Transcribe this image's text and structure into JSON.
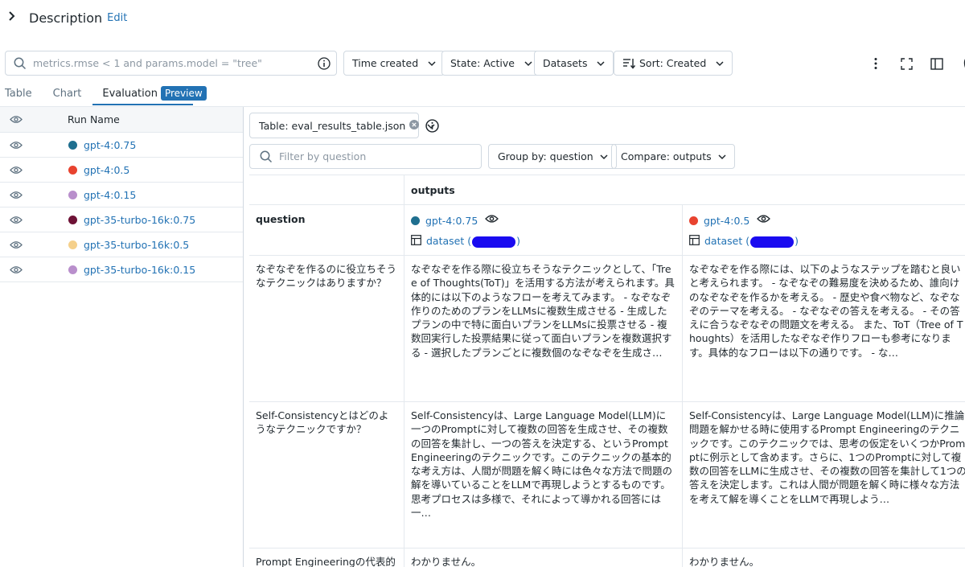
{
  "description": {
    "title": "Description",
    "edit_label": "Edit"
  },
  "search": {
    "placeholder": "metrics.rmse < 1 and params.model = \"tree\""
  },
  "toolbar": {
    "time_created": "Time created",
    "state": "State: Active",
    "datasets": "Datasets",
    "sort": "Sort: Created"
  },
  "tabs": [
    {
      "label": "Table"
    },
    {
      "label": "Chart"
    },
    {
      "label": "Evaluation",
      "badge": "Preview"
    }
  ],
  "runs_panel": {
    "header": "Run Name",
    "runs": [
      {
        "name": "gpt-4:0.75",
        "color": "#1f6f8f"
      },
      {
        "name": "gpt-4:0.5",
        "color": "#e8432f"
      },
      {
        "name": "gpt-4:0.15",
        "color": "#b98fcc"
      },
      {
        "name": "gpt-35-turbo-16k:0.75",
        "color": "#6e1236"
      },
      {
        "name": "gpt-35-turbo-16k:0.5",
        "color": "#f5d08b"
      },
      {
        "name": "gpt-35-turbo-16k:0.15",
        "color": "#b98fcc"
      }
    ]
  },
  "eval": {
    "table_select": "Table: eval_results_table.json",
    "filter_placeholder": "Filter by question",
    "group_by": "Group by: question",
    "compare": "Compare: outputs",
    "outputs_header": "outputs",
    "question_header": "question",
    "columns": [
      {
        "run": "gpt-4:0.75",
        "color": "#1f6f8f",
        "dataset_label": "dataset (",
        "dataset_close": ")"
      },
      {
        "run": "gpt-4:0.5",
        "color": "#e8432f",
        "dataset_label": "dataset (",
        "dataset_close": ")"
      }
    ],
    "rows": [
      {
        "question": "なぞなぞを作るのに役立ちそうなテクニックはありますか？",
        "answers": [
          "なぞなぞを作る際に役立ちそうなテクニックとして、「Tree of Thoughts(ToT)」を活用する方法が考えられます。具体的には以下のようなフローを考えてみます。 - なぞなぞ作りのためのプランをLLMsに複数生成させる - 生成したプランの中で特に面白いプランをLLMsに投票させる - 複数回実行した投票結果に従って面白いプランを複数選択する - 選択したプランごとに複数個のなぞなぞを生成さ…",
          "なぞなぞを作る際には、以下のようなステップを踏むと良いと考えられます。 - なぞなぞの難易度を決めるため、誰向けのなぞなぞを作るかを考える。 - 歴史や食べ物など、なぞなぞのテーマを考える。 - なぞなぞの答えを考える。 - その答えに合うなぞなぞの問題文を考える。 また、ToT（Tree of Thoughts）を活用したなぞなぞ作りフローも参考になります。具体的なフローは以下の通りです。 - な…"
        ]
      },
      {
        "question": "Self-Consistencyとはどのようなテクニックですか？",
        "answers": [
          "Self-Consistencyは、Large Language Model(LLM)に一つのPromptに対して複数の回答を生成させ、その複数の回答を集計し、一つの答えを決定する、というPrompt Engineeringのテクニックです。このテクニックの基本的な考え方は、人間が問題を解く時には色々な方法で問題の解を導いていることをLLMで再現しようとするものです。思考プロセスは多様で、それによって導かれる回答には一…",
          "Self-Consistencyは、Large Language Model(LLM)に推論問題を解かせる時に使用するPrompt Engineeringのテクニックです。このテクニックでは、思考の仮定をいくつかPromptに例示として含めます。さらに、1つのPromptに対して複数の回答をLLMに生成させ、その複数の回答を集計して1つの答えを決定します。これは人間が問題を解く時に様々な方法を考えて解を導くことをLLMで再現しよう…"
        ]
      },
      {
        "question": "Prompt Engineeringの代表的な",
        "answers": [
          "わかりません。",
          "わかりません。"
        ]
      }
    ]
  }
}
